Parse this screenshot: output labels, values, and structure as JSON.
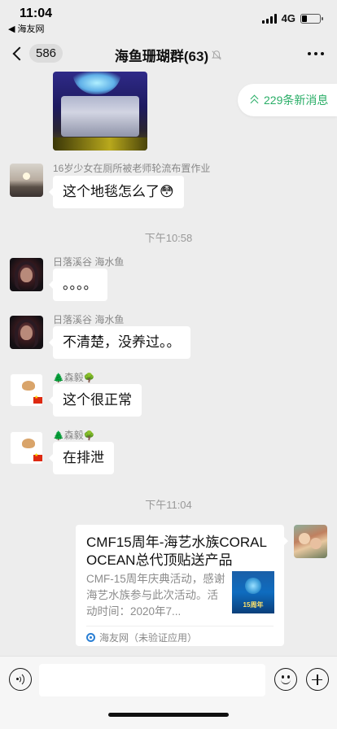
{
  "status_bar": {
    "time": "11:04",
    "back_app": "◀ 海友网",
    "network": "4G",
    "battery_level": 0.3
  },
  "nav": {
    "back_count": "586",
    "title": "海鱼珊瑚群(63)",
    "mute_icon": "bell-slash-icon",
    "more_icon": "more-icon"
  },
  "new_messages_banner": "229条新消息",
  "messages": [
    {
      "sender": "16岁少女在厕所被老师轮流布置作业",
      "text": "这个地毯怎么了😳"
    },
    {
      "sender": "日落溪谷 海水鱼",
      "text": "。。。。"
    },
    {
      "sender": "日落溪谷 海水鱼",
      "text": "不清楚，没养过。。"
    },
    {
      "sender_prefix": "🌲",
      "sender": "森毅",
      "sender_suffix": "🌳",
      "text": "这个很正常"
    },
    {
      "sender_prefix": "🌲",
      "sender": "森毅",
      "sender_suffix": "🌳",
      "text": "在排泄"
    }
  ],
  "timestamps": [
    "下午10:58",
    "下午11:04"
  ],
  "card": {
    "title": "CMF15周年-海艺水族CORAL OCEAN总代顶贴送产品",
    "description": "CMF-15周年庆典活动，感谢海艺水族参与此次活动。活动时间：2020年7...",
    "thumbnail_label": "15周年",
    "source": "海友网（未验证应用）"
  },
  "colors": {
    "background": "#ededed",
    "bubble": "#ffffff",
    "accent_green": "#2aae67"
  }
}
